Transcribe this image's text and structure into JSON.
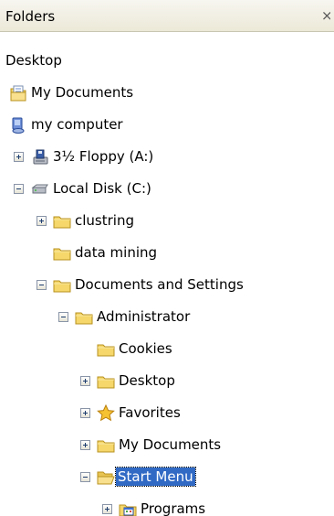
{
  "header": {
    "title": "Folders",
    "close_glyph": "×"
  },
  "tree": {
    "items": [
      {
        "label": "Desktop",
        "icon": "none",
        "expander": "none",
        "selected": false
      },
      {
        "label": "My Documents",
        "icon": "my-documents-icon",
        "expander": "none",
        "selected": false
      },
      {
        "label": "my computer",
        "icon": "my-computer-icon",
        "expander": "none",
        "selected": false
      },
      {
        "label": "3½ Floppy (A:)",
        "icon": "floppy-drive-icon",
        "expander": "plus",
        "selected": false
      },
      {
        "label": "Local Disk (C:)",
        "icon": "hard-disk-icon",
        "expander": "minus",
        "selected": false
      },
      {
        "label": "clustring",
        "icon": "folder-icon",
        "expander": "plus",
        "selected": false
      },
      {
        "label": "data mining",
        "icon": "folder-icon",
        "expander": "none",
        "selected": false
      },
      {
        "label": "Documents and Settings",
        "icon": "folder-icon",
        "expander": "minus",
        "selected": false
      },
      {
        "label": "Administrator",
        "icon": "folder-icon",
        "expander": "minus",
        "selected": false
      },
      {
        "label": "Cookies",
        "icon": "folder-icon",
        "expander": "none",
        "selected": false
      },
      {
        "label": "Desktop",
        "icon": "folder-icon",
        "expander": "plus",
        "selected": false
      },
      {
        "label": "Favorites",
        "icon": "favorites-star-icon",
        "expander": "plus",
        "selected": false
      },
      {
        "label": "My Documents",
        "icon": "folder-icon",
        "expander": "plus",
        "selected": false
      },
      {
        "label": "Start Menu",
        "icon": "open-folder-icon",
        "expander": "minus",
        "selected": true
      },
      {
        "label": "Programs",
        "icon": "programs-folder-icon",
        "expander": "plus",
        "selected": false
      }
    ]
  },
  "colors": {
    "selection": "#316ac5",
    "folder": "#f5d76b",
    "header_bg": "#ece9d8"
  }
}
